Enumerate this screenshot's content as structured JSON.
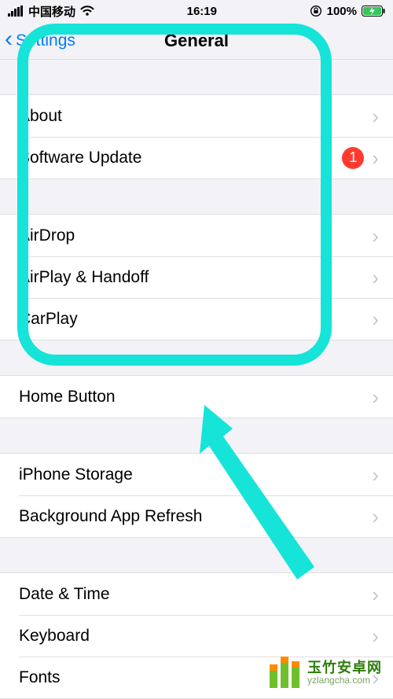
{
  "status_bar": {
    "carrier": "中国移动",
    "time": "16:19",
    "battery": "100%"
  },
  "nav": {
    "back_label": "Settings",
    "title": "General"
  },
  "sections": {
    "s1": {
      "about": "About",
      "software_update": "Software Update",
      "software_update_badge": "1"
    },
    "s2": {
      "airdrop": "AirDrop",
      "airplay": "AirPlay & Handoff",
      "carplay": "CarPlay"
    },
    "s3": {
      "home_button": "Home Button"
    },
    "s4": {
      "storage": "iPhone Storage",
      "bg_refresh": "Background App Refresh"
    },
    "s5": {
      "date_time": "Date & Time",
      "keyboard": "Keyboard",
      "fonts": "Fonts"
    }
  },
  "watermark": {
    "title": "玉竹安卓网",
    "url": "yzlangcha.com"
  }
}
